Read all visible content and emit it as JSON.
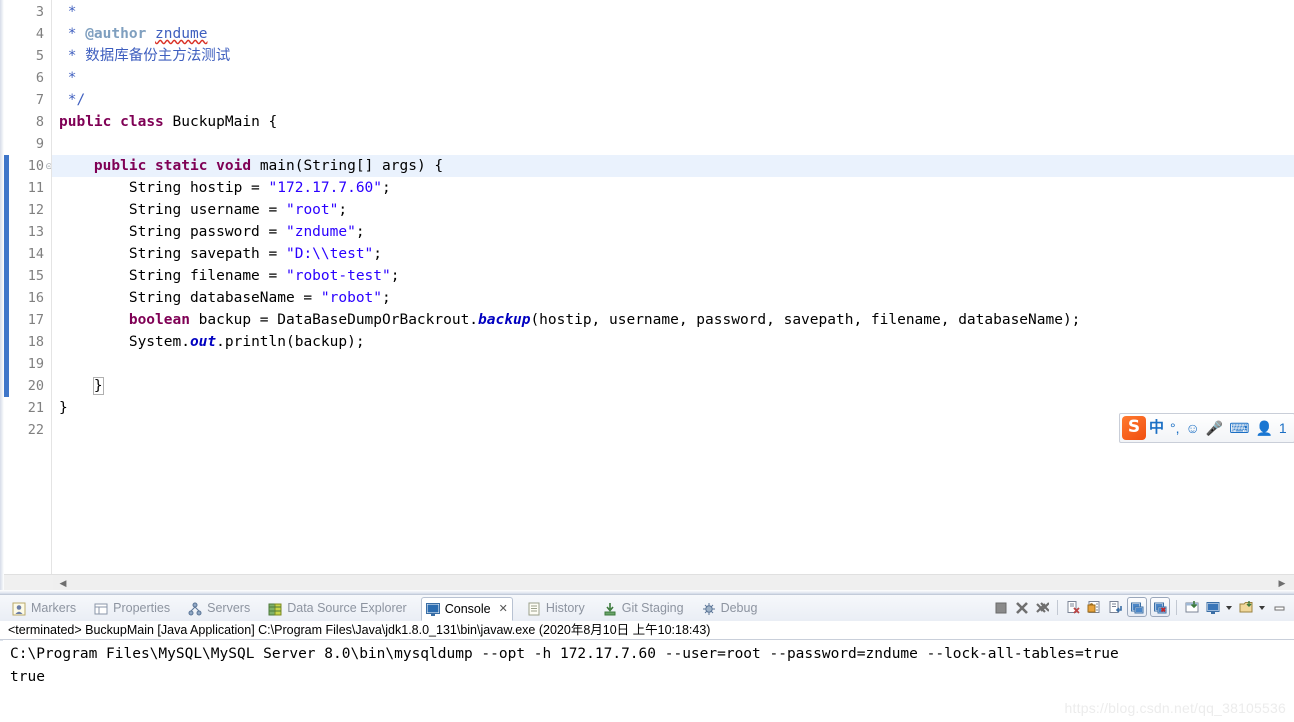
{
  "editor": {
    "first_visible_line": 3,
    "current_line": 10,
    "lines": [
      {
        "num": 3,
        "tokens": [
          {
            "t": "cmt",
            "s": " *"
          }
        ]
      },
      {
        "num": 4,
        "tokens": [
          {
            "t": "cmt",
            "s": " * "
          },
          {
            "t": "cmt-tag",
            "s": "@author"
          },
          {
            "t": "cmt",
            "s": " "
          },
          {
            "t": "cmt-spell",
            "s": "zndume"
          }
        ]
      },
      {
        "num": 5,
        "tokens": [
          {
            "t": "cmt",
            "s": " * 数据库备份主方法测试"
          }
        ]
      },
      {
        "num": 6,
        "tokens": [
          {
            "t": "cmt",
            "s": " *"
          }
        ]
      },
      {
        "num": 7,
        "tokens": [
          {
            "t": "cmt",
            "s": " */"
          }
        ]
      },
      {
        "num": 8,
        "tokens": [
          {
            "t": "kw",
            "s": "public"
          },
          {
            "t": "plain",
            "s": " "
          },
          {
            "t": "kw",
            "s": "class"
          },
          {
            "t": "plain",
            "s": " BuckupMain {"
          }
        ]
      },
      {
        "num": 9,
        "tokens": []
      },
      {
        "num": 10,
        "tokens": [
          {
            "t": "plain",
            "s": "    "
          },
          {
            "t": "kw",
            "s": "public"
          },
          {
            "t": "plain",
            "s": " "
          },
          {
            "t": "kw",
            "s": "static"
          },
          {
            "t": "plain",
            "s": " "
          },
          {
            "t": "kw",
            "s": "void"
          },
          {
            "t": "plain",
            "s": " main(String[] args) {"
          }
        ]
      },
      {
        "num": 11,
        "tokens": [
          {
            "t": "plain",
            "s": "        String hostip = "
          },
          {
            "t": "str",
            "s": "\"172.17.7.60\""
          },
          {
            "t": "plain",
            "s": ";"
          }
        ]
      },
      {
        "num": 12,
        "tokens": [
          {
            "t": "plain",
            "s": "        String username = "
          },
          {
            "t": "str",
            "s": "\"root\""
          },
          {
            "t": "plain",
            "s": ";"
          }
        ]
      },
      {
        "num": 13,
        "tokens": [
          {
            "t": "plain",
            "s": "        String password = "
          },
          {
            "t": "str",
            "s": "\"zndume\""
          },
          {
            "t": "plain",
            "s": ";"
          }
        ]
      },
      {
        "num": 14,
        "tokens": [
          {
            "t": "plain",
            "s": "        String savepath = "
          },
          {
            "t": "str",
            "s": "\"D:\\\\test\""
          },
          {
            "t": "plain",
            "s": ";"
          }
        ]
      },
      {
        "num": 15,
        "tokens": [
          {
            "t": "plain",
            "s": "        String filename = "
          },
          {
            "t": "str",
            "s": "\"robot-test\""
          },
          {
            "t": "plain",
            "s": ";"
          }
        ]
      },
      {
        "num": 16,
        "tokens": [
          {
            "t": "plain",
            "s": "        String databaseName = "
          },
          {
            "t": "str",
            "s": "\"robot\""
          },
          {
            "t": "plain",
            "s": ";"
          }
        ]
      },
      {
        "num": 17,
        "tokens": [
          {
            "t": "plain",
            "s": "        "
          },
          {
            "t": "kw",
            "s": "boolean"
          },
          {
            "t": "plain",
            "s": " backup = DataBaseDumpOrBackrout."
          },
          {
            "t": "fld",
            "s": "backup"
          },
          {
            "t": "plain",
            "s": "(hostip, username, password, savepath, filename, databaseName);"
          }
        ]
      },
      {
        "num": 18,
        "tokens": [
          {
            "t": "plain",
            "s": "        System."
          },
          {
            "t": "fld",
            "s": "out"
          },
          {
            "t": "plain",
            "s": ".println(backup);"
          }
        ]
      },
      {
        "num": 19,
        "tokens": []
      },
      {
        "num": 20,
        "tokens": [
          {
            "t": "plain",
            "s": "    "
          },
          {
            "t": "brkt",
            "s": "}"
          }
        ]
      },
      {
        "num": 21,
        "tokens": [
          {
            "t": "plain",
            "s": "}"
          }
        ]
      },
      {
        "num": 22,
        "tokens": []
      }
    ],
    "scroll_left_arrow": "◀",
    "scroll_right_arrow": "▶"
  },
  "panel": {
    "tabs": [
      {
        "id": "markers",
        "label": "Markers",
        "icon": "markers-icon",
        "active": false
      },
      {
        "id": "properties",
        "label": "Properties",
        "icon": "properties-icon",
        "active": false
      },
      {
        "id": "servers",
        "label": "Servers",
        "icon": "servers-icon",
        "active": false
      },
      {
        "id": "data-source-explorer",
        "label": "Data Source Explorer",
        "icon": "data-source-icon",
        "active": false
      },
      {
        "id": "console",
        "label": "Console",
        "icon": "console-icon",
        "active": true,
        "close": "✕"
      },
      {
        "id": "history",
        "label": "History",
        "icon": "history-icon",
        "active": false
      },
      {
        "id": "git-staging",
        "label": "Git Staging",
        "icon": "git-staging-icon",
        "active": false
      },
      {
        "id": "debug",
        "label": "Debug",
        "icon": "debug-icon",
        "active": false
      }
    ],
    "toolbar": [
      {
        "id": "terminate",
        "icon": "stop-square-icon",
        "framed": false
      },
      {
        "id": "remove-launch",
        "icon": "remove-launch-icon",
        "framed": false
      },
      {
        "id": "remove-all-terminated",
        "icon": "remove-all-terminated-icon",
        "framed": false
      },
      {
        "id": "sep1",
        "icon": "separator",
        "framed": false
      },
      {
        "id": "clear-console",
        "icon": "clear-console-icon",
        "framed": false
      },
      {
        "id": "scroll-lock",
        "icon": "scroll-lock-icon",
        "framed": false
      },
      {
        "id": "word-wrap",
        "icon": "word-wrap-icon",
        "framed": false
      },
      {
        "id": "show-console-on-output",
        "icon": "show-console-stdout-icon",
        "framed": true
      },
      {
        "id": "show-console-on-error",
        "icon": "show-console-stderr-icon",
        "framed": true
      },
      {
        "id": "sep2",
        "icon": "separator",
        "framed": false
      },
      {
        "id": "pin-console",
        "icon": "pin-console-icon",
        "framed": false
      },
      {
        "id": "display-console",
        "icon": "display-selected-console-icon",
        "framed": false
      },
      {
        "id": "display-caret",
        "icon": "chevron-down-icon",
        "framed": false
      },
      {
        "id": "open-console",
        "icon": "open-console-icon",
        "framed": false
      },
      {
        "id": "open-caret",
        "icon": "chevron-down-icon",
        "framed": false
      },
      {
        "id": "minimize",
        "icon": "minimize-icon",
        "framed": false
      }
    ],
    "launch_status": "<terminated> BuckupMain [Java Application] C:\\Program Files\\Java\\jdk1.8.0_131\\bin\\javaw.exe (2020年8月10日 上午10:18:43)",
    "console_output": [
      "C:\\Program Files\\MySQL\\MySQL Server 8.0\\bin\\mysqldump --opt -h 172.17.7.60 --user=root --password=zndume --lock-all-tables=true",
      "true"
    ]
  },
  "ime": {
    "logo": "S",
    "items": [
      {
        "id": "lang",
        "icon": "chinese-mode-icon",
        "label": "中"
      },
      {
        "id": "punct",
        "icon": "punctuation-icon",
        "label": "°,"
      },
      {
        "id": "emoji",
        "icon": "emoji-icon",
        "label": "☺"
      },
      {
        "id": "voice",
        "icon": "microphone-icon",
        "label": "🎤"
      },
      {
        "id": "keyboard",
        "icon": "soft-keyboard-icon",
        "label": "⌨"
      },
      {
        "id": "user",
        "icon": "user-account-icon",
        "label": "👤"
      },
      {
        "id": "more",
        "icon": "more-tools-icon",
        "label": "1"
      }
    ]
  },
  "watermark": "https://blog.csdn.net/qq_38105536",
  "colors": {
    "keyword": "#7f0055",
    "string": "#2a00ff",
    "comment": "#3f5fbf",
    "comment_tag": "#7f9fbf",
    "field": "#0000c0",
    "current_line_bg": "#eaf2fd",
    "quickdiff": "#3f76c9"
  }
}
